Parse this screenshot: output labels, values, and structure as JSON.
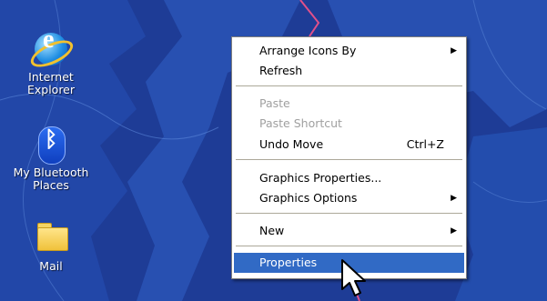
{
  "desktop": {
    "icons": [
      {
        "label": "Internet Explorer",
        "label_lines": [
          "Internet",
          "Explorer"
        ],
        "icon": "internet-explorer-icon"
      },
      {
        "label": "My Bluetooth Places",
        "label_lines": [
          "My Bluetooth",
          "Places"
        ],
        "icon": "bluetooth-icon"
      },
      {
        "label": "Mail",
        "label_lines": [
          "Mail"
        ],
        "icon": "folder-icon"
      }
    ]
  },
  "context_menu": {
    "items": [
      {
        "label": "Arrange Icons By",
        "submenu": true,
        "enabled": true
      },
      {
        "label": "Refresh",
        "enabled": true
      },
      {
        "label": "Paste",
        "enabled": false
      },
      {
        "label": "Paste Shortcut",
        "enabled": false
      },
      {
        "label": "Undo Move",
        "shortcut": "Ctrl+Z",
        "enabled": true
      },
      {
        "label": "Graphics Properties...",
        "enabled": true
      },
      {
        "label": "Graphics Options",
        "submenu": true,
        "enabled": true
      },
      {
        "label": "New",
        "submenu": true,
        "enabled": true
      },
      {
        "label": "Properties",
        "enabled": true,
        "highlighted": true
      }
    ],
    "submenu_arrow": "▶"
  },
  "colors": {
    "desktop_blue": "#1f3f9a",
    "highlight": "#316ac5",
    "disabled_text": "#a0a0a0"
  }
}
